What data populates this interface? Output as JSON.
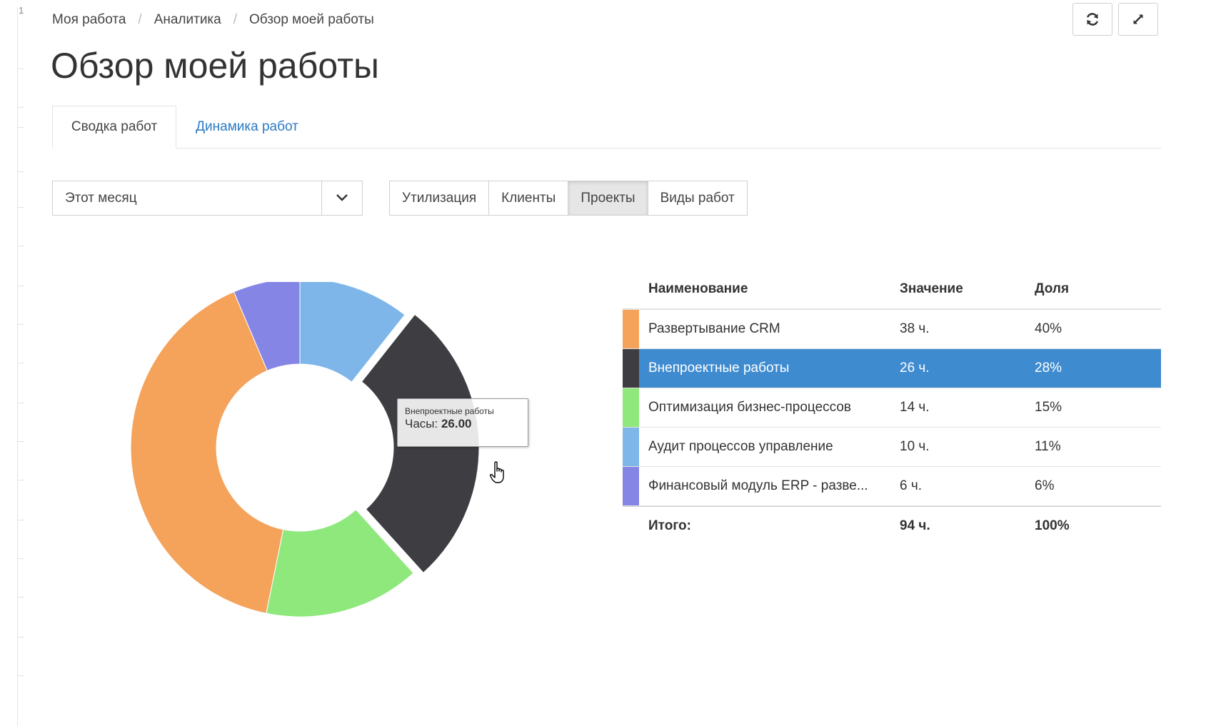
{
  "breadcrumb": [
    "Моя работа",
    "Аналитика",
    "Обзор моей работы"
  ],
  "page_title": "Обзор моей работы",
  "toolbar": {
    "refresh_icon": "refresh-icon",
    "fullscreen_icon": "expand-icon"
  },
  "tabs": [
    {
      "label": "Сводка работ",
      "active": true
    },
    {
      "label": "Динамика работ",
      "active": false
    }
  ],
  "period_select": {
    "value": "Этот месяц",
    "icon": "chevron-down-icon"
  },
  "view_buttons": [
    {
      "label": "Утилизация",
      "active": false
    },
    {
      "label": "Клиенты",
      "active": false
    },
    {
      "label": "Проекты",
      "active": true
    },
    {
      "label": "Виды работ",
      "active": false
    }
  ],
  "table": {
    "headers": {
      "name": "Наименование",
      "value": "Значение",
      "share": "Доля"
    },
    "rows": [
      {
        "name": "Развертывание CRM",
        "value": "38 ч.",
        "share": "40%",
        "color": "#f5a25b",
        "selected": false
      },
      {
        "name": "Внепроектные работы",
        "value": "26 ч.",
        "share": "28%",
        "color": "#3d3d42",
        "selected": true
      },
      {
        "name": "Оптимизация бизнес-процессов",
        "value": "14 ч.",
        "share": "15%",
        "color": "#8ee87c",
        "selected": false
      },
      {
        "name": "Аудит процессов управление",
        "value": "10 ч.",
        "share": "11%",
        "color": "#7eb6ea",
        "selected": false
      },
      {
        "name": "Финансовый модуль ERP - разве...",
        "value": "6 ч.",
        "share": "6%",
        "color": "#8585e6",
        "selected": false
      }
    ],
    "total": {
      "name": "Итого:",
      "value": "94 ч.",
      "share": "100%"
    }
  },
  "tooltip": {
    "title": "Внепроектные работы",
    "label": "Часы: ",
    "value": "26.00"
  },
  "chart_data": {
    "type": "pie",
    "categories": [
      "Аудит процессов управление",
      "Внепроектные работы",
      "Оптимизация бизнес-процессов",
      "Развертывание CRM",
      "Финансовый модуль ERP - разве..."
    ],
    "values": [
      10,
      26,
      14,
      38,
      6
    ],
    "colors": [
      "#7eb6ea",
      "#3d3d42",
      "#8ee87c",
      "#f5a25b",
      "#8585e6"
    ],
    "donut": true,
    "highlighted": "Внепроектные работы",
    "unit": "ч."
  }
}
